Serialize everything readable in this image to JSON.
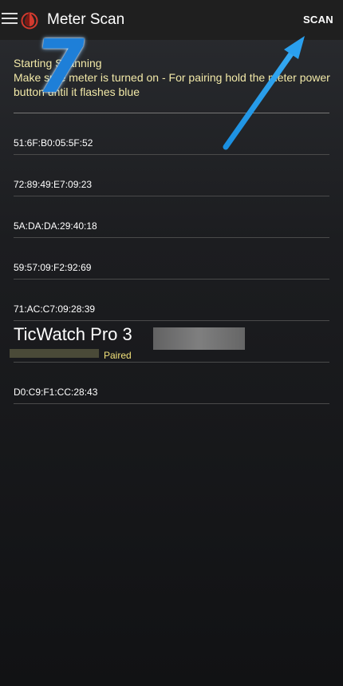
{
  "app": {
    "title": "Meter Scan",
    "scan_label": "SCAN"
  },
  "status": {
    "line1": "Starting Scanning",
    "line2": "Make sure meter is turned on - For pairing hold the meter power button until it flashes blue"
  },
  "devices": [
    {
      "mac": "51:6F:B0:05:5F:52"
    },
    {
      "mac": "72:89:49:E7:09:23"
    },
    {
      "mac": "5A:DA:DA:29:40:18"
    },
    {
      "mac": "59:57:09:F2:92:69"
    },
    {
      "mac": "71:AC:C7:09:28:39"
    }
  ],
  "paired_device": {
    "name": "TicWatch Pro 3",
    "status": "Paired"
  },
  "last_device": {
    "mac": "D0:C9:F1:CC:28:43"
  },
  "annotation": {
    "step_number": "7"
  },
  "colors": {
    "appbar": "#1f1f1f",
    "status_text": "#f2e9a8",
    "paired_text": "#f2e27a",
    "arrow": "#1a8fe0",
    "drop_icon": "#d23a2e"
  },
  "icons": {
    "menu": "hamburger-menu-icon",
    "app": "blood-drop-icon"
  }
}
